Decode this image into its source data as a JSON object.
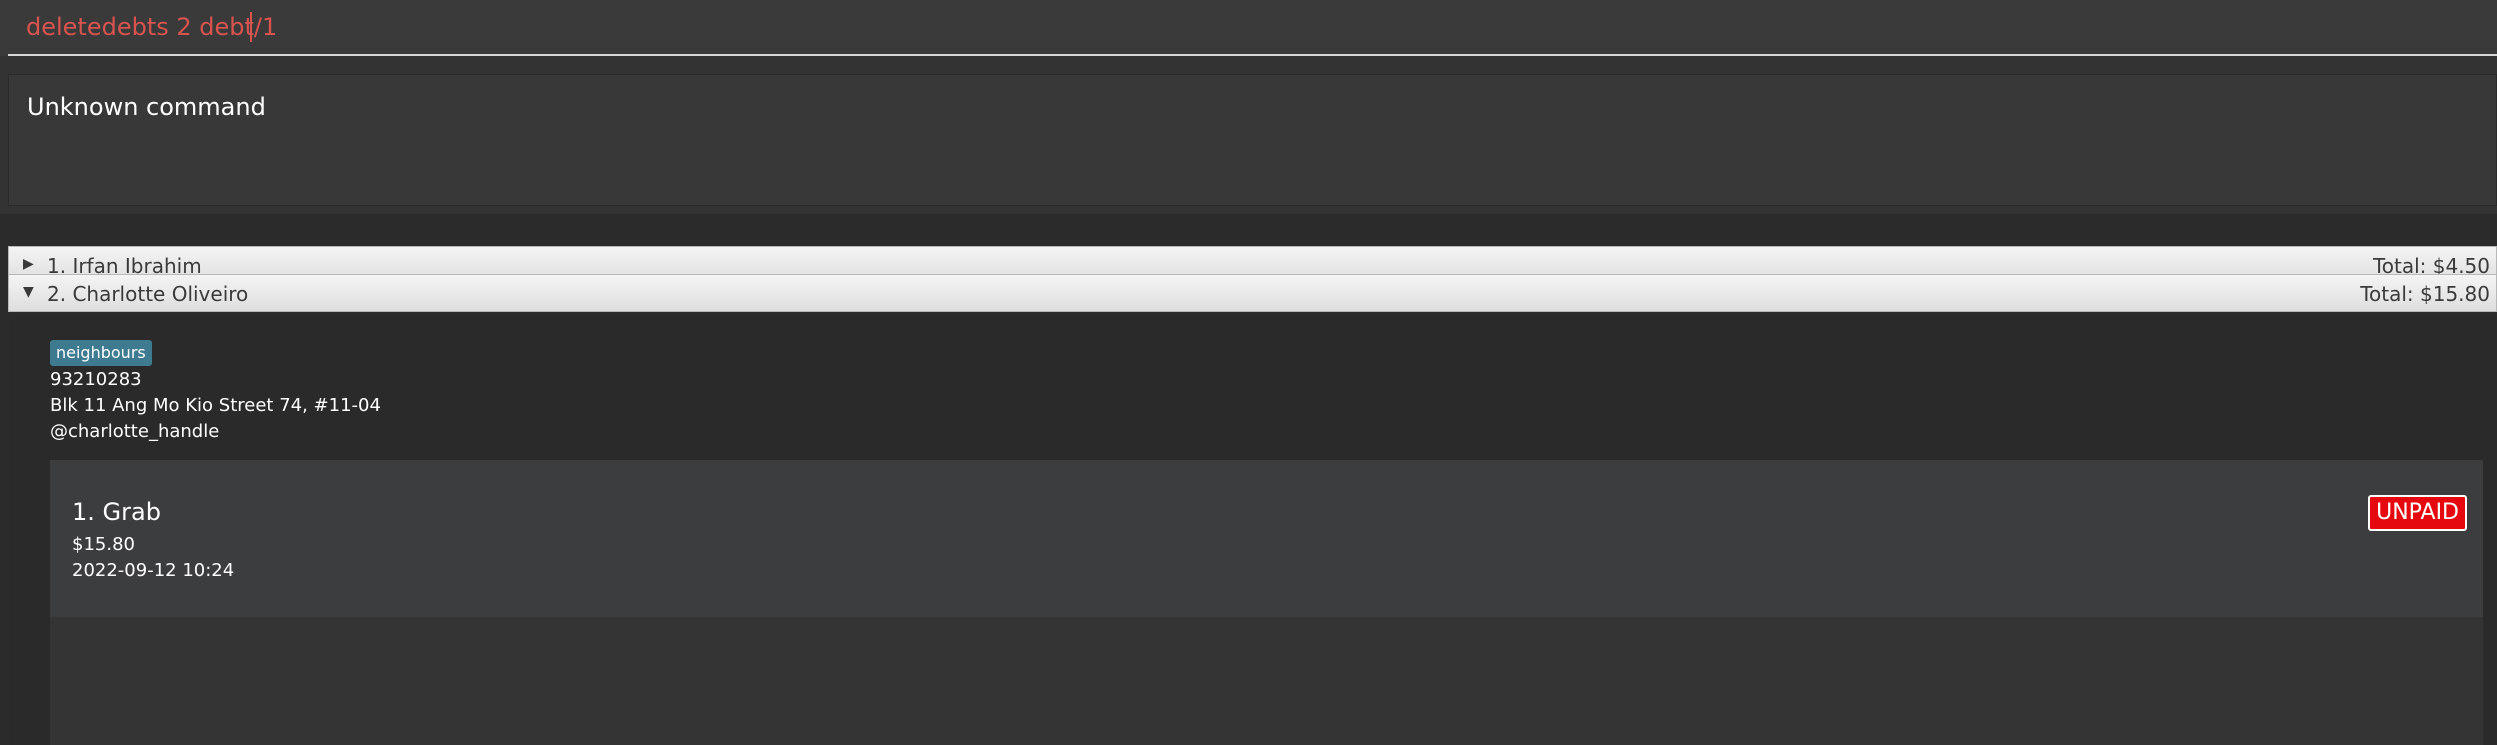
{
  "command_box": {
    "value": "deletedebts 2 debt/1"
  },
  "result_display": {
    "text": "Unknown command"
  },
  "person_list": [
    {
      "header": "1. Irfan Ibrahim",
      "total": "Total: $4.50",
      "expanded": false
    },
    {
      "header": "2. Charlotte Oliveiro",
      "total": "Total: $15.80",
      "expanded": true,
      "tag": "neighbours",
      "phone": "93210283",
      "address": "Blk 11 Ang Mo Kio Street 74, #11-04",
      "telegram": "@charlotte_handle",
      "debts": [
        {
          "title": "1.  Grab",
          "amount": "$15.80",
          "datetime": "2022-09-12 10:24",
          "status": "UNPAID"
        }
      ]
    }
  ],
  "icons": {
    "collapsed": "triangle-right-icon",
    "expanded": "triangle-down-icon"
  },
  "colors": {
    "command_text": "#d9534f",
    "tag_bg": "#3e7b91",
    "unpaid_badge": "#e5090f"
  }
}
